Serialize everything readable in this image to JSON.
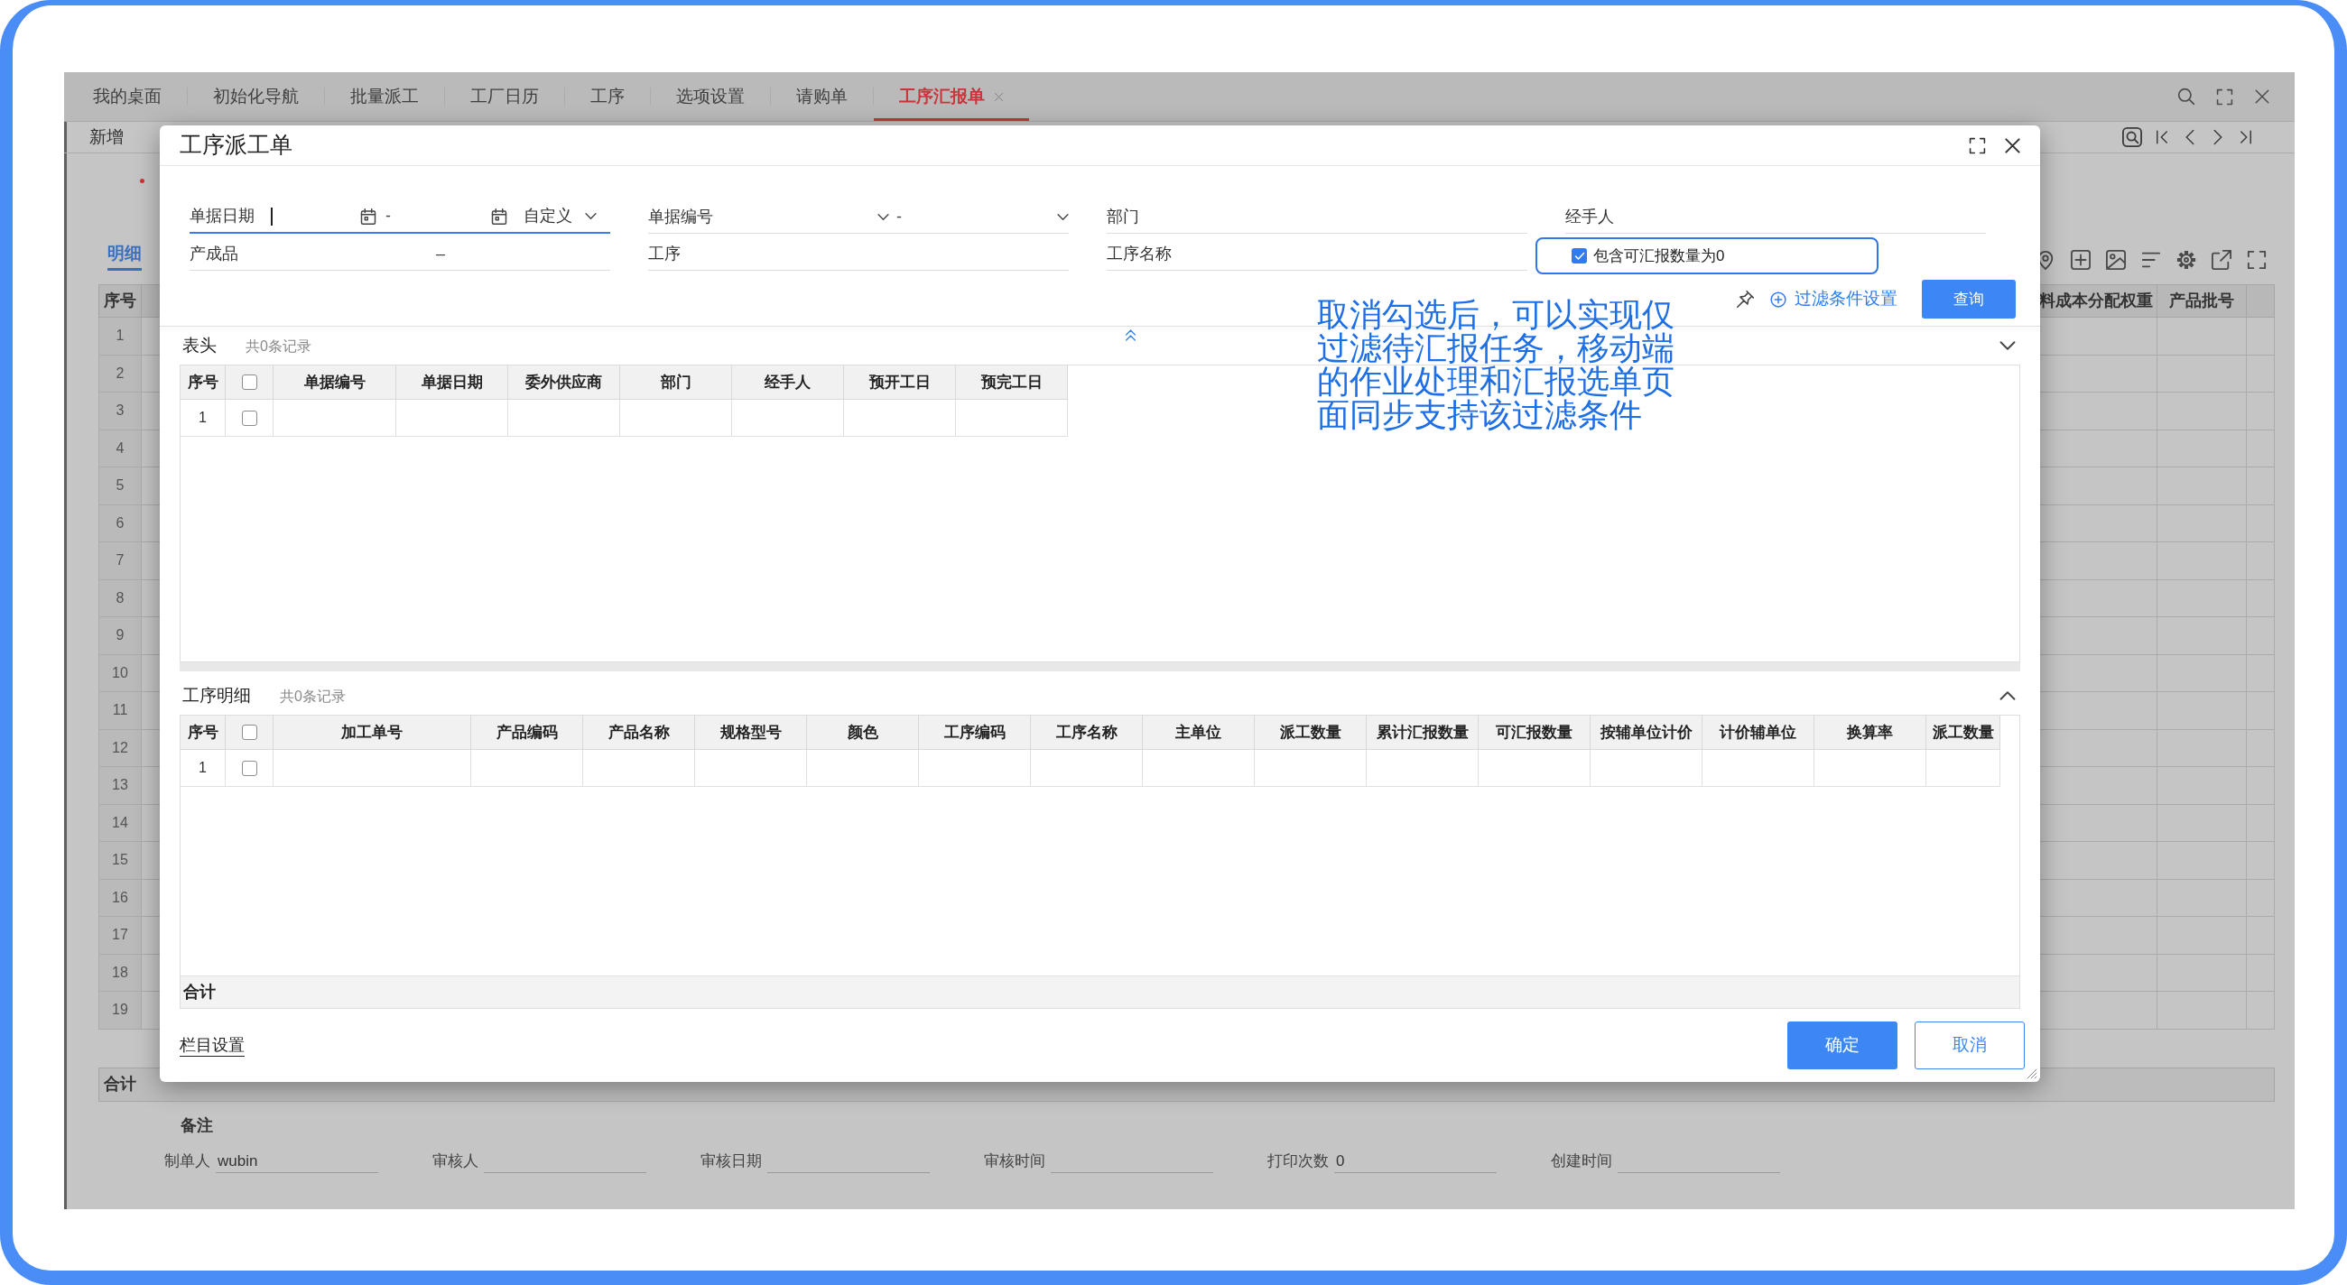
{
  "page": {
    "tabs": [
      {
        "label": "我的桌面",
        "selected": false
      },
      {
        "label": "初始化导航",
        "selected": false
      },
      {
        "label": "批量派工",
        "selected": false
      },
      {
        "label": "工厂日历",
        "selected": false
      },
      {
        "label": "工序",
        "selected": false
      },
      {
        "label": "选项设置",
        "selected": false
      },
      {
        "label": "请购单",
        "selected": false
      },
      {
        "label": "工序汇报单",
        "selected": true
      }
    ],
    "toolbar": {
      "new_button": "新增"
    },
    "detail_tab": {
      "label": "明细",
      "selected": true
    },
    "grid": {
      "columns": [
        "序号",
        "料成本分配权重",
        "产品批号"
      ],
      "row_numbers": [
        "1",
        "2",
        "3",
        "4",
        "5",
        "6",
        "7",
        "8",
        "9",
        "10",
        "11",
        "12",
        "13",
        "14",
        "15",
        "16",
        "17",
        "18",
        "19"
      ],
      "total_label": "合计"
    },
    "remarks_label": "备注",
    "footer_fields": [
      {
        "label": "制单人",
        "value": "wubin"
      },
      {
        "label": "审核人"
      },
      {
        "label": "审核日期"
      },
      {
        "label": "审核时间"
      },
      {
        "label": "打印次数",
        "value": "0"
      },
      {
        "label": "创建时间"
      }
    ]
  },
  "dialog": {
    "title": "工序派工单",
    "filters": [
      {
        "label": "单据日期",
        "kind": "date_range",
        "separator": "-",
        "preset": "自定义",
        "focused": true
      },
      {
        "label": "单据编号",
        "kind": "select_range",
        "separator": "-",
        "focused": false
      },
      {
        "label": "部门",
        "kind": "text",
        "focused": false
      },
      {
        "label": "经手人",
        "kind": "text",
        "focused": false
      },
      {
        "label": "产成品",
        "kind": "range",
        "separator": "–",
        "focused": false
      },
      {
        "label": "工序",
        "kind": "text",
        "focused": false
      },
      {
        "label": "工序名称",
        "kind": "text",
        "focused": false
      }
    ],
    "include_zero": {
      "label": "包含可汇报数量为0",
      "checked": true,
      "highlighted": true
    },
    "filter_settings_link": "过滤条件设置",
    "query_button": "查询",
    "sections": [
      {
        "kind": "header",
        "title": "表头",
        "count": "共0条记录",
        "index_column": "序号",
        "select_all_checked": false,
        "columns": [
          "单据编号",
          "单据日期",
          "委外供应商",
          "部门",
          "经手人",
          "预开工日",
          "预完工日"
        ],
        "rows": [
          {
            "index": "1",
            "checked": false
          }
        ]
      },
      {
        "kind": "detail",
        "title": "工序明细",
        "count": "共0条记录",
        "index_column": "序号",
        "select_all_checked": false,
        "columns": [
          "加工单号",
          "产品编码",
          "产品名称",
          "规格型号",
          "颜色",
          "工序编码",
          "工序名称",
          "主单位",
          "派工数量",
          "累计汇报数量",
          "可汇报数量",
          "按辅单位计价",
          "计价辅单位",
          "换算率",
          "派工数量"
        ],
        "rows": [
          {
            "index": "1",
            "checked": false
          }
        ],
        "total_label": "合计"
      }
    ],
    "column_settings_link": "栏目设置",
    "buttons": [
      {
        "label": "确定",
        "kind": "primary"
      },
      {
        "label": "取消",
        "kind": "secondary"
      }
    ]
  },
  "annotation": {
    "text": "取消勾选后，可以实现仅过滤待汇报任务，移动端的作业处理和汇报选单页面同步支持该过滤条件"
  }
}
